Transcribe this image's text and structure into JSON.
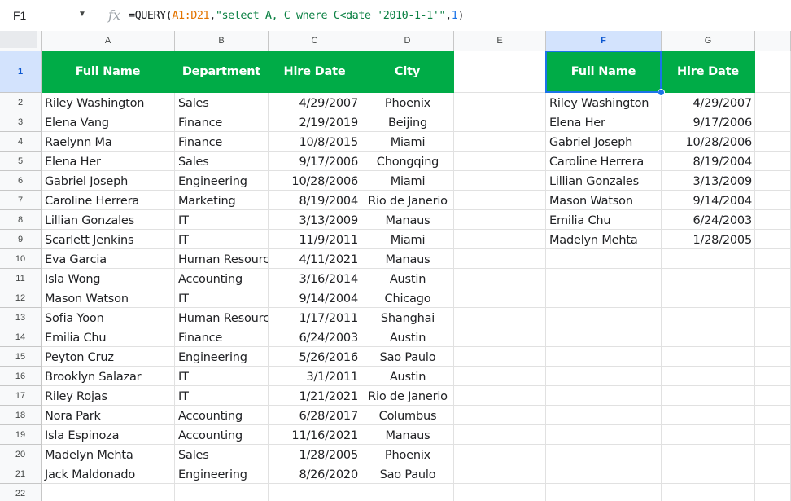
{
  "formula_bar": {
    "name_box": "F1",
    "fx_label": "fx",
    "formula_parts": [
      {
        "text": "=QUERY(",
        "kind": "plain"
      },
      {
        "text": "A1:D21",
        "kind": "range"
      },
      {
        "text": ",",
        "kind": "plain"
      },
      {
        "text": "\"select A, C where C<date '2010-1-1'\"",
        "kind": "string"
      },
      {
        "text": ",",
        "kind": "plain"
      },
      {
        "text": "1",
        "kind": "number"
      },
      {
        "text": ")",
        "kind": "plain"
      }
    ]
  },
  "columns": [
    "A",
    "B",
    "C",
    "D",
    "E",
    "F",
    "G"
  ],
  "selected_column": "F",
  "selected_row": "1",
  "row_numbers": [
    "1",
    "2",
    "3",
    "4",
    "5",
    "6",
    "7",
    "8",
    "9",
    "10",
    "11",
    "12",
    "13",
    "14",
    "15",
    "16",
    "17",
    "18",
    "19",
    "20",
    "21",
    "22"
  ],
  "source_table": {
    "headers": [
      "Full Name",
      "Department",
      "Hire Date",
      "City"
    ],
    "rows": [
      [
        "Riley Washington",
        "Sales",
        "4/29/2007",
        "Phoenix"
      ],
      [
        "Elena Vang",
        "Finance",
        "2/19/2019",
        "Beijing"
      ],
      [
        "Raelynn Ma",
        "Finance",
        "10/8/2015",
        "Miami"
      ],
      [
        "Elena Her",
        "Sales",
        "9/17/2006",
        "Chongqing"
      ],
      [
        "Gabriel Joseph",
        "Engineering",
        "10/28/2006",
        "Miami"
      ],
      [
        "Caroline Herrera",
        "Marketing",
        "8/19/2004",
        "Rio de Janerio"
      ],
      [
        "Lillian Gonzales",
        "IT",
        "3/13/2009",
        "Manaus"
      ],
      [
        "Scarlett Jenkins",
        "IT",
        "11/9/2011",
        "Miami"
      ],
      [
        "Eva Garcia",
        "Human Resourc",
        "4/11/2021",
        "Manaus"
      ],
      [
        "Isla Wong",
        "Accounting",
        "3/16/2014",
        "Austin"
      ],
      [
        "Mason Watson",
        "IT",
        "9/14/2004",
        "Chicago"
      ],
      [
        "Sofia Yoon",
        "Human Resourc",
        "1/17/2011",
        "Shanghai"
      ],
      [
        "Emilia Chu",
        "Finance",
        "6/24/2003",
        "Austin"
      ],
      [
        "Peyton Cruz",
        "Engineering",
        "5/26/2016",
        "Sao Paulo"
      ],
      [
        "Brooklyn Salazar",
        "IT",
        "3/1/2011",
        "Austin"
      ],
      [
        "Riley Rojas",
        "IT",
        "1/21/2021",
        "Rio de Janerio"
      ],
      [
        "Nora Park",
        "Accounting",
        "6/28/2017",
        "Columbus"
      ],
      [
        "Isla Espinoza",
        "Accounting",
        "11/16/2021",
        "Manaus"
      ],
      [
        "Madelyn Mehta",
        "Sales",
        "1/28/2005",
        "Phoenix"
      ],
      [
        "Jack Maldonado",
        "Engineering",
        "8/26/2020",
        "Sao Paulo"
      ]
    ]
  },
  "result_table": {
    "headers": [
      "Full Name",
      "Hire Date"
    ],
    "rows": [
      [
        "Riley Washington",
        "4/29/2007"
      ],
      [
        "Elena Her",
        "9/17/2006"
      ],
      [
        "Gabriel Joseph",
        "10/28/2006"
      ],
      [
        "Caroline Herrera",
        "8/19/2004"
      ],
      [
        "Lillian Gonzales",
        "3/13/2009"
      ],
      [
        "Mason Watson",
        "9/14/2004"
      ],
      [
        "Emilia Chu",
        "6/24/2003"
      ],
      [
        "Madelyn Mehta",
        "1/28/2005"
      ]
    ]
  },
  "colors": {
    "header_fill": "#00ac47",
    "header_text": "#ffffff",
    "selection": "#1a73e8",
    "selected_header_fill": "#d3e3fd",
    "range_token": "#e37400",
    "string_token": "#0b8043",
    "number_token": "#1a73e8"
  }
}
